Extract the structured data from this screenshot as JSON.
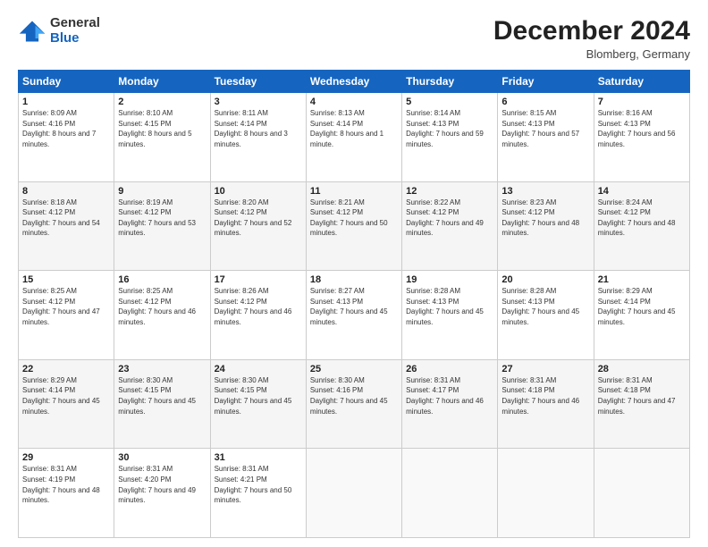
{
  "header": {
    "logo_general": "General",
    "logo_blue": "Blue",
    "month_title": "December 2024",
    "subtitle": "Blomberg, Germany"
  },
  "days_of_week": [
    "Sunday",
    "Monday",
    "Tuesday",
    "Wednesday",
    "Thursday",
    "Friday",
    "Saturday"
  ],
  "weeks": [
    [
      {
        "day": "1",
        "sunrise": "8:09 AM",
        "sunset": "4:16 PM",
        "daylight": "8 hours and 7 minutes."
      },
      {
        "day": "2",
        "sunrise": "8:10 AM",
        "sunset": "4:15 PM",
        "daylight": "8 hours and 5 minutes."
      },
      {
        "day": "3",
        "sunrise": "8:11 AM",
        "sunset": "4:14 PM",
        "daylight": "8 hours and 3 minutes."
      },
      {
        "day": "4",
        "sunrise": "8:13 AM",
        "sunset": "4:14 PM",
        "daylight": "8 hours and 1 minute."
      },
      {
        "day": "5",
        "sunrise": "8:14 AM",
        "sunset": "4:13 PM",
        "daylight": "7 hours and 59 minutes."
      },
      {
        "day": "6",
        "sunrise": "8:15 AM",
        "sunset": "4:13 PM",
        "daylight": "7 hours and 57 minutes."
      },
      {
        "day": "7",
        "sunrise": "8:16 AM",
        "sunset": "4:13 PM",
        "daylight": "7 hours and 56 minutes."
      }
    ],
    [
      {
        "day": "8",
        "sunrise": "8:18 AM",
        "sunset": "4:12 PM",
        "daylight": "7 hours and 54 minutes."
      },
      {
        "day": "9",
        "sunrise": "8:19 AM",
        "sunset": "4:12 PM",
        "daylight": "7 hours and 53 minutes."
      },
      {
        "day": "10",
        "sunrise": "8:20 AM",
        "sunset": "4:12 PM",
        "daylight": "7 hours and 52 minutes."
      },
      {
        "day": "11",
        "sunrise": "8:21 AM",
        "sunset": "4:12 PM",
        "daylight": "7 hours and 50 minutes."
      },
      {
        "day": "12",
        "sunrise": "8:22 AM",
        "sunset": "4:12 PM",
        "daylight": "7 hours and 49 minutes."
      },
      {
        "day": "13",
        "sunrise": "8:23 AM",
        "sunset": "4:12 PM",
        "daylight": "7 hours and 48 minutes."
      },
      {
        "day": "14",
        "sunrise": "8:24 AM",
        "sunset": "4:12 PM",
        "daylight": "7 hours and 48 minutes."
      }
    ],
    [
      {
        "day": "15",
        "sunrise": "8:25 AM",
        "sunset": "4:12 PM",
        "daylight": "7 hours and 47 minutes."
      },
      {
        "day": "16",
        "sunrise": "8:25 AM",
        "sunset": "4:12 PM",
        "daylight": "7 hours and 46 minutes."
      },
      {
        "day": "17",
        "sunrise": "8:26 AM",
        "sunset": "4:12 PM",
        "daylight": "7 hours and 46 minutes."
      },
      {
        "day": "18",
        "sunrise": "8:27 AM",
        "sunset": "4:13 PM",
        "daylight": "7 hours and 45 minutes."
      },
      {
        "day": "19",
        "sunrise": "8:28 AM",
        "sunset": "4:13 PM",
        "daylight": "7 hours and 45 minutes."
      },
      {
        "day": "20",
        "sunrise": "8:28 AM",
        "sunset": "4:13 PM",
        "daylight": "7 hours and 45 minutes."
      },
      {
        "day": "21",
        "sunrise": "8:29 AM",
        "sunset": "4:14 PM",
        "daylight": "7 hours and 45 minutes."
      }
    ],
    [
      {
        "day": "22",
        "sunrise": "8:29 AM",
        "sunset": "4:14 PM",
        "daylight": "7 hours and 45 minutes."
      },
      {
        "day": "23",
        "sunrise": "8:30 AM",
        "sunset": "4:15 PM",
        "daylight": "7 hours and 45 minutes."
      },
      {
        "day": "24",
        "sunrise": "8:30 AM",
        "sunset": "4:15 PM",
        "daylight": "7 hours and 45 minutes."
      },
      {
        "day": "25",
        "sunrise": "8:30 AM",
        "sunset": "4:16 PM",
        "daylight": "7 hours and 45 minutes."
      },
      {
        "day": "26",
        "sunrise": "8:31 AM",
        "sunset": "4:17 PM",
        "daylight": "7 hours and 46 minutes."
      },
      {
        "day": "27",
        "sunrise": "8:31 AM",
        "sunset": "4:18 PM",
        "daylight": "7 hours and 46 minutes."
      },
      {
        "day": "28",
        "sunrise": "8:31 AM",
        "sunset": "4:18 PM",
        "daylight": "7 hours and 47 minutes."
      }
    ],
    [
      {
        "day": "29",
        "sunrise": "8:31 AM",
        "sunset": "4:19 PM",
        "daylight": "7 hours and 48 minutes."
      },
      {
        "day": "30",
        "sunrise": "8:31 AM",
        "sunset": "4:20 PM",
        "daylight": "7 hours and 49 minutes."
      },
      {
        "day": "31",
        "sunrise": "8:31 AM",
        "sunset": "4:21 PM",
        "daylight": "7 hours and 50 minutes."
      },
      null,
      null,
      null,
      null
    ]
  ]
}
